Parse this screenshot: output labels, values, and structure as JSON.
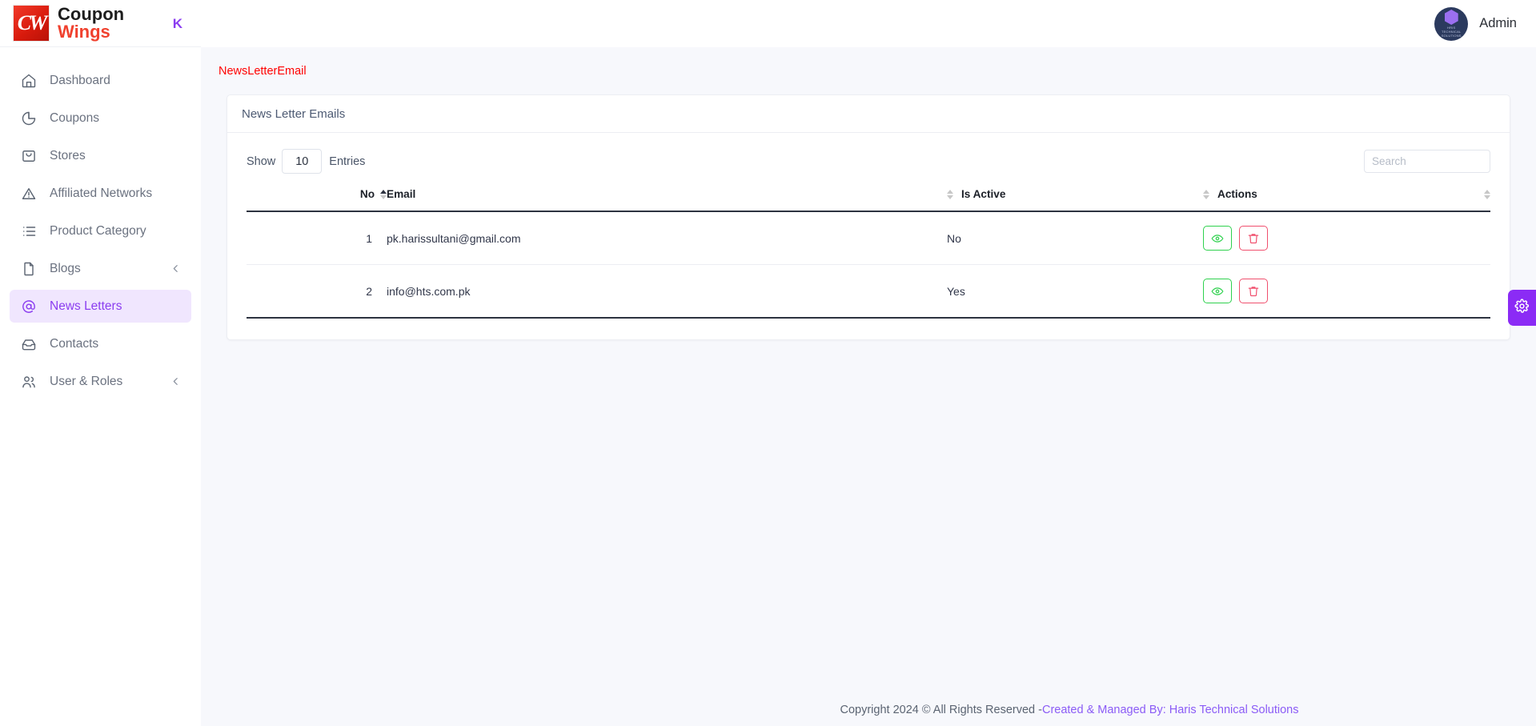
{
  "brand": {
    "logo_mark_text": "CW",
    "line1": "Coupon",
    "line2": "Wings",
    "collapse_icon": "chevron-left-bar-icon",
    "collapse_label": "K"
  },
  "sidebar": {
    "items": [
      {
        "label": "Dashboard",
        "icon": "home-icon",
        "active": false,
        "expandable": false
      },
      {
        "label": "Coupons",
        "icon": "pie-chart-icon",
        "active": false,
        "expandable": false
      },
      {
        "label": "Stores",
        "icon": "shopping-bag-icon",
        "active": false,
        "expandable": false
      },
      {
        "label": "Affiliated Networks",
        "icon": "alert-triangle-icon",
        "active": false,
        "expandable": false
      },
      {
        "label": "Product Category",
        "icon": "list-icon",
        "active": false,
        "expandable": false
      },
      {
        "label": "Blogs",
        "icon": "file-icon",
        "active": false,
        "expandable": true
      },
      {
        "label": "News Letters",
        "icon": "at-sign-icon",
        "active": true,
        "expandable": false
      },
      {
        "label": "Contacts",
        "icon": "inbox-icon",
        "active": false,
        "expandable": false
      },
      {
        "label": "User & Roles",
        "icon": "users-icon",
        "active": false,
        "expandable": true
      }
    ]
  },
  "topbar": {
    "user_name": "Admin",
    "avatar_icon": "hexagon-logo-icon",
    "avatar_line1": "HRIS",
    "avatar_line2": "TECHNICAL SOLUTIONS"
  },
  "breadcrumb": {
    "label": "NewsLetterEmail"
  },
  "card": {
    "title": "News Letter Emails"
  },
  "controls": {
    "show_label": "Show",
    "entries_label": "Entries",
    "page_length": "10",
    "search_placeholder": "Search",
    "search_value": ""
  },
  "table": {
    "columns": [
      {
        "label": "No",
        "sort": "asc"
      },
      {
        "label": "Email",
        "sort": "none"
      },
      {
        "label": "Is Active",
        "sort": "none"
      },
      {
        "label": "Actions",
        "sort": "none"
      }
    ],
    "rows": [
      {
        "no": "1",
        "email": "pk.harissultani@gmail.com",
        "is_active": "No",
        "view_icon": "eye-icon",
        "delete_icon": "trash-icon"
      },
      {
        "no": "2",
        "email": "info@hts.com.pk",
        "is_active": "Yes",
        "view_icon": "eye-icon",
        "delete_icon": "trash-icon"
      }
    ]
  },
  "settings_tab": {
    "icon": "gear-icon",
    "color": "#8b2bf5"
  },
  "footer": {
    "text": "Copyright 2024 © All Rights Reserved - ",
    "link": "Created & Managed By: Haris Technical Solutions"
  },
  "colors": {
    "accent_purple": "#8b3df0",
    "breadcrumb_red": "#ff0000",
    "success_green": "#2fd14e",
    "danger_red": "#f0506e",
    "brand_red": "#f0412e"
  }
}
